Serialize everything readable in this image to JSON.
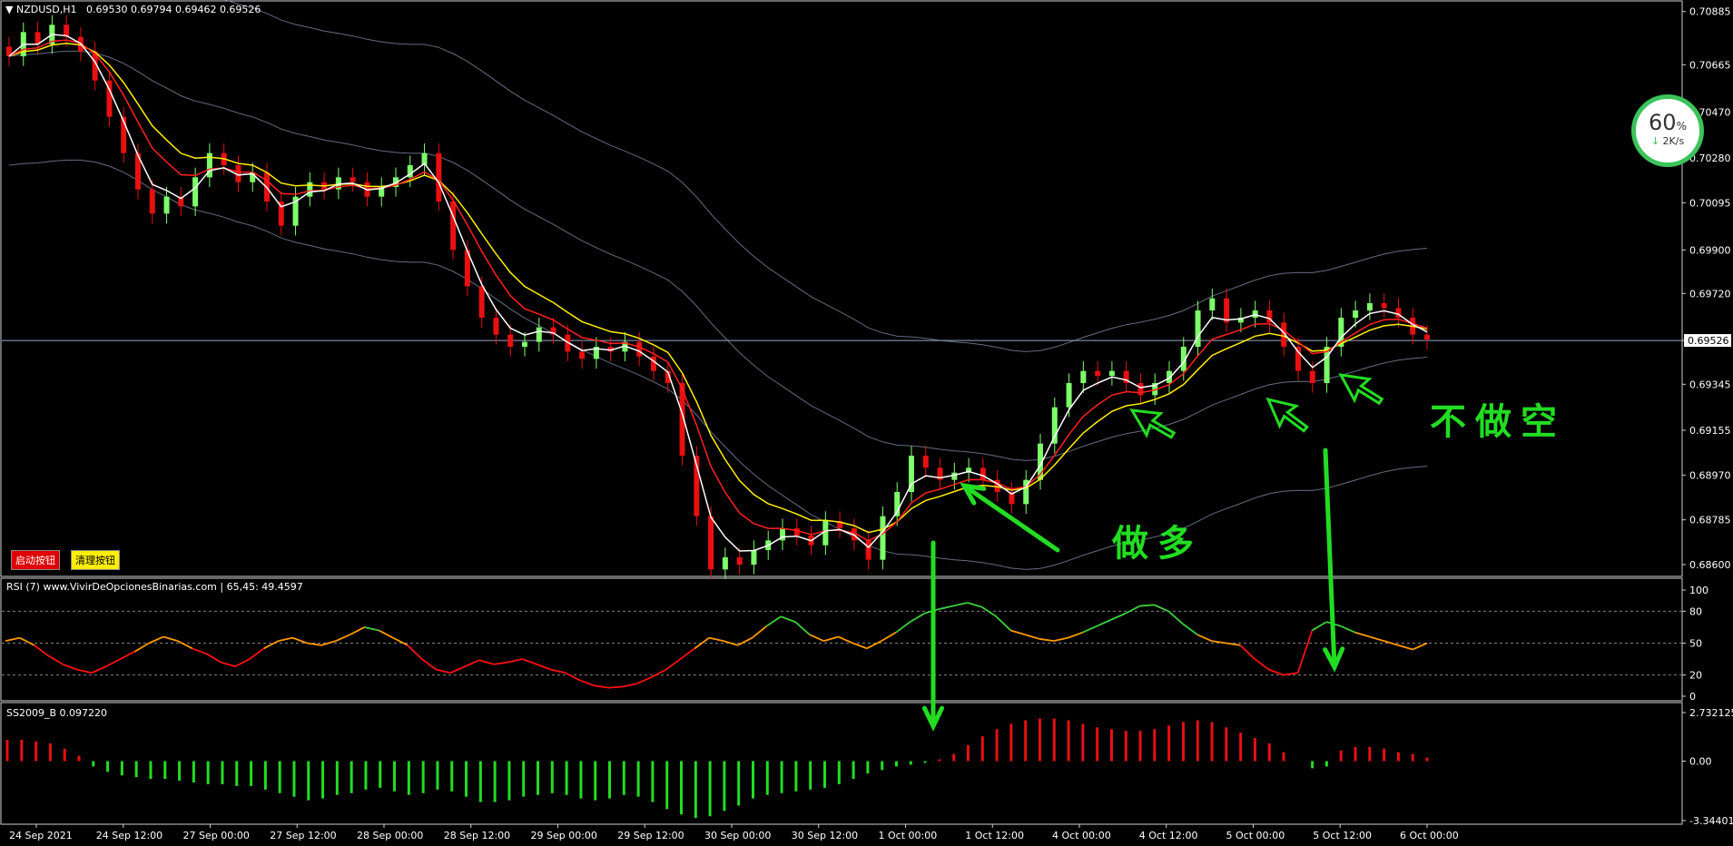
{
  "header": {
    "symbol": "NZDUSD,H1",
    "ohlc": "0.69530 0.69794 0.69462 0.69526"
  },
  "buttons": {
    "start": "启动按钮",
    "clear": "清理按钮"
  },
  "speed_widget": {
    "percent": "60",
    "unit": "%",
    "rate": "2K/s"
  },
  "annotations": {
    "long": "做多",
    "no_short": "不做空"
  },
  "colors": {
    "bull": "#7dff6a",
    "bear": "#e81010",
    "ema_fast": "#ffffff",
    "ema_mid": "#ff2020",
    "ema_slow": "#ffee00",
    "band": "#8f98b8",
    "green": "#22dd22",
    "rsi_green": "#3ccf3c",
    "rsi_orange": "#ff9900",
    "rsi_red": "#ff1010"
  },
  "chart_data": [
    {
      "type": "candlestick",
      "name": "NZDUSD,H1",
      "y_ticks": [
        "0.70885",
        "0.70665",
        "0.70470",
        "0.70280",
        "0.70095",
        "0.69900",
        "0.69720",
        "0.69526",
        "0.69345",
        "0.69155",
        "0.68970",
        "0.68785",
        "0.68600"
      ],
      "ylim": [
        0.6857,
        0.7091
      ],
      "current_price": "0.69526",
      "x_ticks": [
        "24 Sep 2021",
        "24 Sep 12:00",
        "27 Sep 00:00",
        "27 Sep 12:00",
        "28 Sep 00:00",
        "28 Sep 12:00",
        "29 Sep 00:00",
        "29 Sep 12:00",
        "30 Sep 00:00",
        "30 Sep 12:00",
        "1 Oct 00:00",
        "1 Oct 12:00",
        "4 Oct 00:00",
        "4 Oct 12:00",
        "5 Oct 00:00",
        "5 Oct 12:00",
        "6 Oct 00:00"
      ],
      "closes": [
        0.707,
        0.708,
        0.7075,
        0.7083,
        0.7078,
        0.7072,
        0.706,
        0.7045,
        0.703,
        0.7015,
        0.7005,
        0.7012,
        0.7008,
        0.702,
        0.703,
        0.7025,
        0.7018,
        0.7022,
        0.701,
        0.7,
        0.7012,
        0.7018,
        0.7015,
        0.702,
        0.7018,
        0.7012,
        0.7016,
        0.702,
        0.7025,
        0.703,
        0.701,
        0.699,
        0.6975,
        0.6962,
        0.6955,
        0.695,
        0.6952,
        0.6958,
        0.6955,
        0.6948,
        0.6945,
        0.695,
        0.6948,
        0.6952,
        0.6946,
        0.694,
        0.6935,
        0.6905,
        0.688,
        0.6858,
        0.6863,
        0.686,
        0.6866,
        0.687,
        0.6875,
        0.6872,
        0.6868,
        0.6878,
        0.6875,
        0.687,
        0.6862,
        0.688,
        0.689,
        0.6905,
        0.69,
        0.6895,
        0.6898,
        0.69,
        0.6895,
        0.689,
        0.6885,
        0.6895,
        0.691,
        0.6925,
        0.6935,
        0.694,
        0.6938,
        0.694,
        0.6935,
        0.693,
        0.6935,
        0.694,
        0.695,
        0.6965,
        0.697,
        0.696,
        0.6962,
        0.6965,
        0.696,
        0.695,
        0.694,
        0.6935,
        0.695,
        0.6962,
        0.6965,
        0.6968,
        0.6966,
        0.6962,
        0.6955,
        0.6953
      ],
      "bands": [
        "upper",
        "mid",
        "lower"
      ]
    },
    {
      "type": "line",
      "name": "RSI (7) www.VivirDeOpcionesBinarias.com | 65,45: 49.4597",
      "y_ticks": [
        "100",
        "80",
        "50",
        "20",
        "0"
      ],
      "ylim": [
        0,
        100
      ],
      "levels": [
        80,
        50,
        20
      ],
      "values": [
        52,
        55,
        48,
        38,
        30,
        25,
        22,
        28,
        35,
        42,
        50,
        56,
        52,
        45,
        40,
        32,
        28,
        35,
        45,
        52,
        55,
        50,
        48,
        52,
        58,
        65,
        62,
        55,
        48,
        35,
        25,
        22,
        28,
        34,
        30,
        32,
        35,
        30,
        25,
        22,
        15,
        10,
        8,
        9,
        12,
        18,
        25,
        35,
        45,
        55,
        52,
        48,
        55,
        66,
        75,
        70,
        58,
        52,
        56,
        50,
        45,
        52,
        60,
        70,
        78,
        82,
        85,
        88,
        84,
        75,
        62,
        58,
        54,
        52,
        55,
        60,
        66,
        72,
        78,
        85,
        86,
        80,
        68,
        58,
        52,
        50,
        48,
        35,
        25,
        20,
        22,
        62,
        70,
        66,
        60,
        56,
        52,
        48,
        44,
        50
      ]
    },
    {
      "type": "bar",
      "name": "SS2009_B 0.097220",
      "y_ticks": [
        "2.732125",
        "0.00",
        "-3.344015"
      ],
      "ylim": [
        -3.344015,
        2.732125
      ],
      "values": [
        1.2,
        1.2,
        1.1,
        1.0,
        0.7,
        0.3,
        -0.3,
        -0.6,
        -0.8,
        -0.9,
        -1.0,
        -1.0,
        -1.1,
        -1.2,
        -1.3,
        -1.3,
        -1.4,
        -1.4,
        -1.6,
        -1.8,
        -2.0,
        -2.2,
        -2.1,
        -1.9,
        -1.8,
        -1.6,
        -1.5,
        -1.7,
        -1.9,
        -1.8,
        -1.6,
        -1.7,
        -2.0,
        -2.3,
        -2.3,
        -2.2,
        -2.0,
        -1.9,
        -1.8,
        -1.9,
        -2.1,
        -2.2,
        -2.1,
        -1.9,
        -2.0,
        -2.3,
        -2.7,
        -3.0,
        -3.2,
        -3.1,
        -2.8,
        -2.5,
        -2.1,
        -1.9,
        -1.8,
        -1.7,
        -1.6,
        -1.5,
        -1.3,
        -1.0,
        -0.7,
        -0.5,
        -0.3,
        -0.2,
        -0.1,
        0.1,
        0.4,
        0.9,
        1.4,
        1.8,
        2.1,
        2.3,
        2.4,
        2.4,
        2.3,
        2.1,
        1.9,
        1.8,
        1.7,
        1.7,
        1.8,
        2.0,
        2.2,
        2.3,
        2.2,
        1.9,
        1.6,
        1.3,
        1.0,
        0.5,
        0.0,
        -0.4,
        -0.3,
        0.6,
        0.8,
        0.8,
        0.7,
        0.5,
        0.4,
        0.2
      ]
    }
  ]
}
